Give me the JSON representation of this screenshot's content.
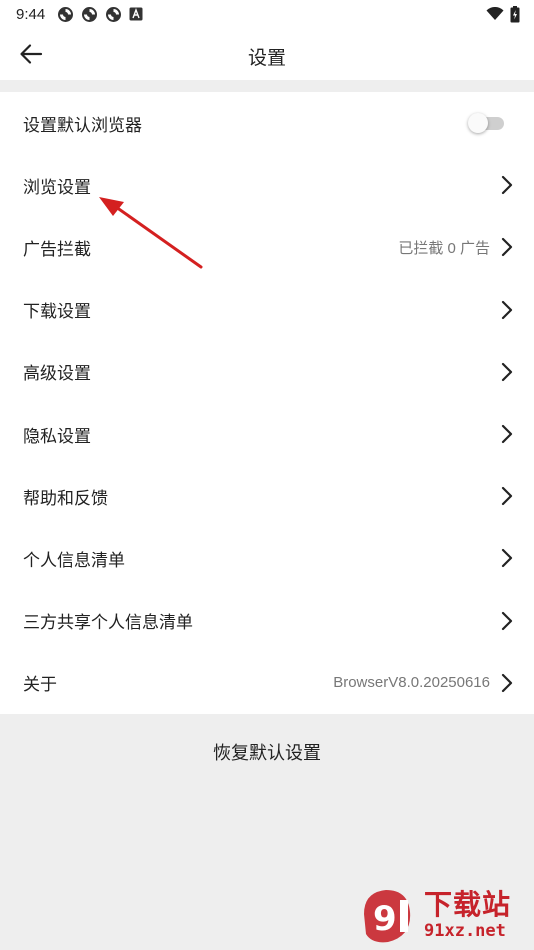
{
  "status_bar": {
    "time": "9:44",
    "notification_icons": [
      "sync-icon",
      "sync-icon",
      "sync-icon",
      "a-letter-icon"
    ],
    "right_icons": [
      "wifi-icon",
      "battery-icon"
    ]
  },
  "app_bar": {
    "title": "设置",
    "back_icon": "arrow-left-icon"
  },
  "settings": {
    "items": [
      {
        "label": "设置默认浏览器",
        "value": "",
        "control": "toggle",
        "toggle_on": false
      },
      {
        "label": "浏览设置",
        "value": "",
        "control": "chevron"
      },
      {
        "label": "广告拦截",
        "value": "已拦截 0 广告",
        "control": "chevron"
      },
      {
        "label": "下载设置",
        "value": "",
        "control": "chevron"
      },
      {
        "label": "高级设置",
        "value": "",
        "control": "chevron"
      },
      {
        "label": "隐私设置",
        "value": "",
        "control": "chevron"
      },
      {
        "label": "帮助和反馈",
        "value": "",
        "control": "chevron"
      },
      {
        "label": "个人信息清单",
        "value": "",
        "control": "chevron"
      },
      {
        "label": "三方共享个人信息清单",
        "value": "",
        "control": "chevron"
      },
      {
        "label": "关于",
        "value": "BrowserV8.0.20250616",
        "control": "chevron"
      }
    ]
  },
  "reset": {
    "label": "恢复默认设置"
  },
  "watermark": {
    "title": "下载站",
    "site": "91xz.net"
  },
  "colors": {
    "background": "#eeeeee",
    "surface": "#ffffff",
    "text": "#222222",
    "secondary_text": "#777777",
    "annotation_arrow": "#d42020",
    "watermark": "#c6232b"
  }
}
